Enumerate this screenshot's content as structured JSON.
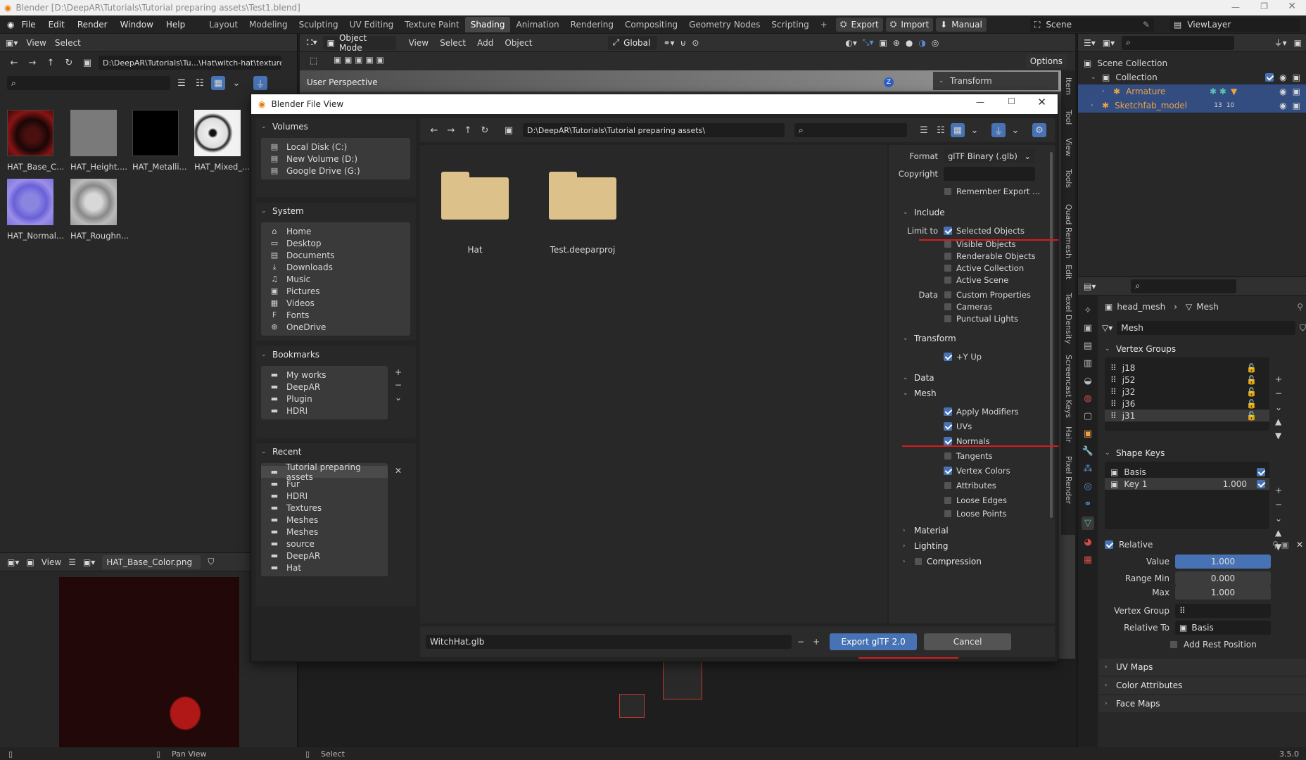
{
  "title_bar": {
    "title": "Blender [D:\\DeepAR\\Tutorials\\Tutorial preparing assets\\Test1.blend]"
  },
  "top_menu": {
    "items": [
      "File",
      "Edit",
      "Render",
      "Window",
      "Help"
    ]
  },
  "workspaces": {
    "tabs": [
      "Layout",
      "Modeling",
      "Sculpting",
      "UV Editing",
      "Texture Paint",
      "Shading",
      "Animation",
      "Rendering",
      "Compositing",
      "Geometry Nodes",
      "Scripting"
    ],
    "active": "Shading"
  },
  "quick_buttons": {
    "export": "Export",
    "import": "Import",
    "manual": "Manual"
  },
  "scene": {
    "label": "Scene",
    "viewlayer": "ViewLayer"
  },
  "file_browser": {
    "view": "View",
    "select": "Select",
    "path": "D:\\DeepAR\\Tutorials\\Tu...\\Hat\\witch-hat\\textures\\",
    "thumbs": [
      "HAT_Base_C...",
      "HAT_Height....",
      "HAT_Metalli...",
      "HAT_Mixed_...",
      "HAT_Normal...",
      "HAT_Roughn..."
    ]
  },
  "image_editor": {
    "view": "View",
    "image": "HAT_Base_Color.png"
  },
  "viewport": {
    "mode": "Object Mode",
    "menus": [
      "View",
      "Select",
      "Add",
      "Object"
    ],
    "orient": "Global",
    "perspective": "User Perspective",
    "options": "Options",
    "transform": "Transform"
  },
  "vtabs": {
    "items": [
      "Item",
      "Tool",
      "View",
      "Tools",
      "Quad Remesh",
      "Edit",
      "Texel Density",
      "Screencast Keys",
      "Hair",
      "Pixel Render"
    ]
  },
  "outliner": {
    "scene_collection": "Scene Collection",
    "collection": "Collection",
    "armature": "Armature",
    "sketchfab": "Sketchfab_model",
    "badge1": "13",
    "badge2": "10"
  },
  "properties": {
    "object": "head_mesh",
    "data_type": "Mesh",
    "mesh_name": "Mesh",
    "vertex_groups_title": "Vertex Groups",
    "vertex_groups": [
      "j18",
      "j52",
      "j32",
      "j36",
      "j31"
    ],
    "shape_keys_title": "Shape Keys",
    "shape_keys": [
      {
        "name": "Basis",
        "value": ""
      },
      {
        "name": "Key 1",
        "value": "1.000"
      }
    ],
    "relative": "Relative",
    "value_label": "Value",
    "value": "1.000",
    "range_min_label": "Range Min",
    "range_min": "0.000",
    "max_label": "Max",
    "max": "1.000",
    "vertex_group_label": "Vertex Group",
    "relative_to_label": "Relative To",
    "relative_to": "Basis",
    "add_rest": "Add Rest Position",
    "uv_maps": "UV Maps",
    "color_attributes": "Color Attributes",
    "face_maps": "Face Maps"
  },
  "status": {
    "pan": "Pan View",
    "select": "Select",
    "version": "3.5.0"
  },
  "dialog": {
    "title": "Blender File View",
    "path": "D:\\DeepAR\\Tutorials\\Tutorial preparing assets\\",
    "volumes_title": "Volumes",
    "volumes": [
      "Local Disk (C:)",
      "New Volume (D:)",
      "Google Drive (G:)"
    ],
    "system_title": "System",
    "system": [
      "Home",
      "Desktop",
      "Documents",
      "Downloads",
      "Music",
      "Pictures",
      "Videos",
      "Fonts",
      "OneDrive"
    ],
    "bookmarks_title": "Bookmarks",
    "bookmarks": [
      "My works",
      "DeepAR",
      "Plugin",
      "HDRI"
    ],
    "recent_title": "Recent",
    "recent": [
      "Tutorial preparing assets",
      "Fur",
      "HDRI",
      "Textures",
      "Meshes",
      "Meshes",
      "source",
      "DeepAR",
      "Hat"
    ],
    "folders": [
      "Hat",
      "Test.deeparproj"
    ],
    "filename": "WitchHat.glb",
    "export_btn": "Export glTF 2.0",
    "cancel_btn": "Cancel",
    "settings": {
      "format_label": "Format",
      "format": "glTF Binary (.glb)",
      "copyright_label": "Copyright",
      "remember": "Remember Export ...",
      "include": "Include",
      "limit_to": "Limit to",
      "selected_objects": "Selected Objects",
      "visible_objects": "Visible Objects",
      "renderable_objects": "Renderable Objects",
      "active_collection": "Active Collection",
      "active_scene": "Active Scene",
      "data_label": "Data",
      "custom_properties": "Custom Properties",
      "cameras": "Cameras",
      "punctual_lights": "Punctual Lights",
      "transform": "Transform",
      "y_up": "+Y Up",
      "data": "Data",
      "mesh": "Mesh",
      "apply_modifiers": "Apply Modifiers",
      "uvs": "UVs",
      "normals": "Normals",
      "tangents": "Tangents",
      "vertex_colors": "Vertex Colors",
      "attributes": "Attributes",
      "loose_edges": "Loose Edges",
      "loose_points": "Loose Points",
      "material": "Material",
      "lighting": "Lighting",
      "compression": "Compression"
    }
  },
  "colors": {
    "accent": "#4772b3",
    "highlight_red": "#d31d1d",
    "folder": "#dcc28a",
    "armature": "#e9a14a",
    "sketchfab": "#e9a14a"
  }
}
